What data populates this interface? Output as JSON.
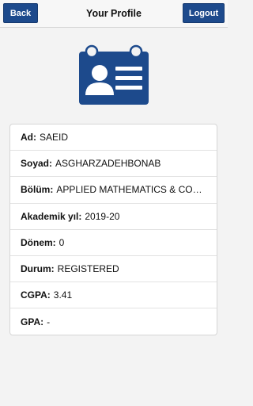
{
  "header": {
    "back_label": "Back",
    "title": "Your Profile",
    "logout_label": "Logout"
  },
  "badge_icon": "id-card-icon",
  "accent_color": "#1d4a8c",
  "profile": {
    "rows": [
      {
        "label": "Ad:",
        "value": "SAEID"
      },
      {
        "label": "Soyad:",
        "value": "ASGHARZADEHBONAB"
      },
      {
        "label": "Bölüm:",
        "value": "APPLIED MATHEMATICS & COMPUTER SCIENCE"
      },
      {
        "label": "Akademik yıl:",
        "value": "2019-20"
      },
      {
        "label": "Dönem:",
        "value": "0"
      },
      {
        "label": "Durum:",
        "value": "REGISTERED"
      },
      {
        "label": "CGPA:",
        "value": "3.41"
      },
      {
        "label": "GPA:",
        "value": "-"
      }
    ]
  }
}
